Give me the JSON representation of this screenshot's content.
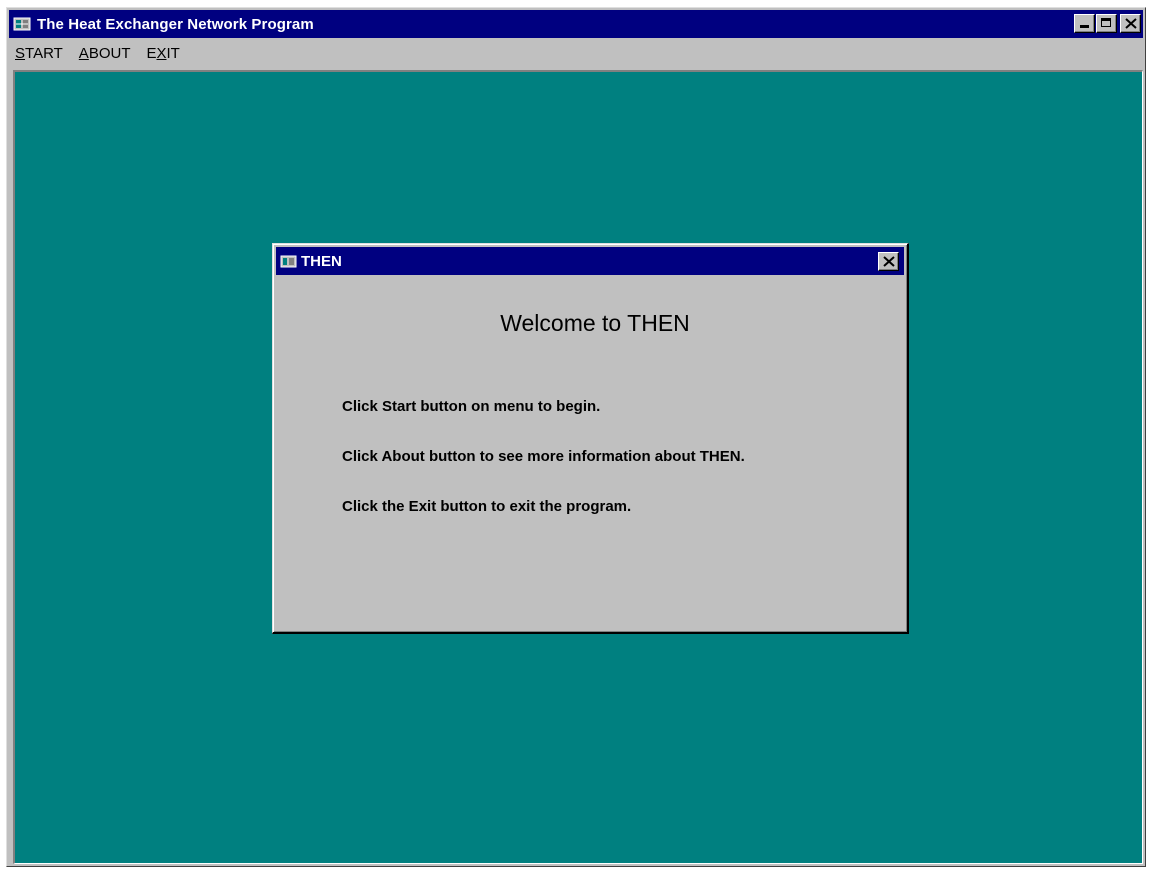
{
  "window": {
    "title": "The Heat Exchanger Network Program",
    "icon": "app-icon"
  },
  "menu": {
    "items": [
      {
        "underline": "S",
        "rest_after": "TART",
        "rest_before": "",
        "label": "START"
      },
      {
        "underline": "A",
        "rest_after": "BOUT",
        "rest_before": "",
        "label": "ABOUT"
      },
      {
        "underline": "X",
        "rest_before": "E",
        "rest_after": "IT",
        "label": "EXIT"
      }
    ]
  },
  "dialog": {
    "title": "THEN",
    "heading": "Welcome to THEN",
    "lines": [
      "Click Start button on menu to begin.",
      "Click About button to see more information about THEN.",
      "Click the Exit button to exit the program."
    ]
  },
  "colors": {
    "titlebar": "#000080",
    "desktop": "#008080",
    "face": "#c0c0c0"
  }
}
